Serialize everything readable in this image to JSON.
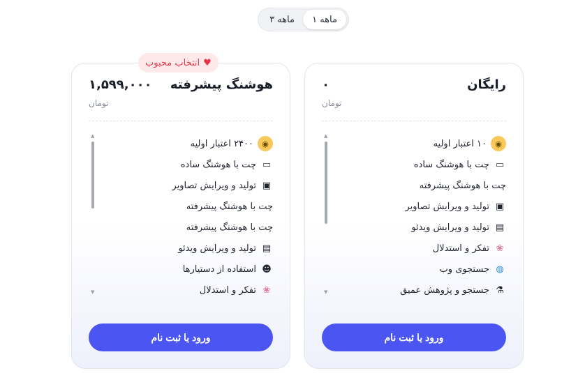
{
  "toggle": {
    "options": [
      "۱ ماهه",
      "۳ ماهه"
    ],
    "selected": "۱ ماهه"
  },
  "plans": [
    {
      "id": "free",
      "title": "رایگان",
      "price": "۰",
      "currency": "تومان",
      "cta": "ورود یا ثبت نام",
      "features": [
        {
          "icon": "credit-icon",
          "glyph": "⊙",
          "text": "۱۰ اعتبار اولیه"
        },
        {
          "icon": "chat-icon",
          "glyph": "💬",
          "text": "چت با هوشنگ ساده"
        },
        {
          "icon": "",
          "glyph": "",
          "text": "چت با هوشنگ پیشرفته"
        },
        {
          "icon": "image-icon",
          "glyph": "🖼",
          "text": "تولید و ویرایش تصاویر"
        },
        {
          "icon": "video-icon",
          "glyph": "🎞",
          "text": "تولید و ویرایش ویدئو"
        },
        {
          "icon": "brain-icon",
          "glyph": "🧠",
          "text": "تفکر و استدلال"
        },
        {
          "icon": "globe-icon",
          "glyph": "🌐",
          "text": "جستجوی وب"
        },
        {
          "icon": "microscope-icon",
          "glyph": "🔬",
          "text": "جستجو و پژوهش عمیق"
        }
      ]
    },
    {
      "id": "pro",
      "title": "هوشنگ پیشرفته",
      "price": "۱,۵۹۹,۰۰۰",
      "currency": "تومان",
      "cta": "ورود یا ثبت نام",
      "badge": "انتخاب محبوب",
      "features": [
        {
          "icon": "credit-icon",
          "glyph": "⊙",
          "text": "۲۴۰۰ اعتبار اولیه"
        },
        {
          "icon": "chat-icon",
          "glyph": "💬",
          "text": "چت با هوشنگ ساده"
        },
        {
          "icon": "image-icon",
          "glyph": "🖼",
          "text": "تولید و ویرایش تصاویر"
        },
        {
          "icon": "",
          "glyph": "",
          "text": "چت با هوشنگ پیشرفته"
        },
        {
          "icon": "",
          "glyph": "",
          "text": "چت با هوشنگ پیشرفته"
        },
        {
          "icon": "video-icon",
          "glyph": "🎞",
          "text": "تولید و ویرایش ویدئو"
        },
        {
          "icon": "agent-icon",
          "glyph": "🤖",
          "text": "استفاده از دستیارها"
        },
        {
          "icon": "brain-icon",
          "glyph": "🧠",
          "text": "تفکر و استدلال"
        }
      ]
    }
  ],
  "colors": {
    "accent": "#4b55f2",
    "badge_bg": "#fde8ea",
    "badge_text": "#e23b4d",
    "credit_coin": "#f8c95a"
  }
}
